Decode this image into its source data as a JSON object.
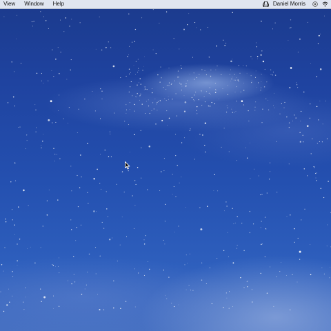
{
  "menubar": {
    "items": [
      {
        "label": "View"
      },
      {
        "label": "Window"
      },
      {
        "label": "Help"
      }
    ],
    "user_name": "Daniel Morris",
    "status_icons": [
      "drive-icon",
      "notification-icon",
      "wifi-icon"
    ]
  },
  "desktop": {
    "wallpaper": "starry-night-sky",
    "colors": {
      "sky_top": "#1b3a8c",
      "sky_bottom": "#4670c2",
      "menubar": "#e8ecf4"
    }
  }
}
